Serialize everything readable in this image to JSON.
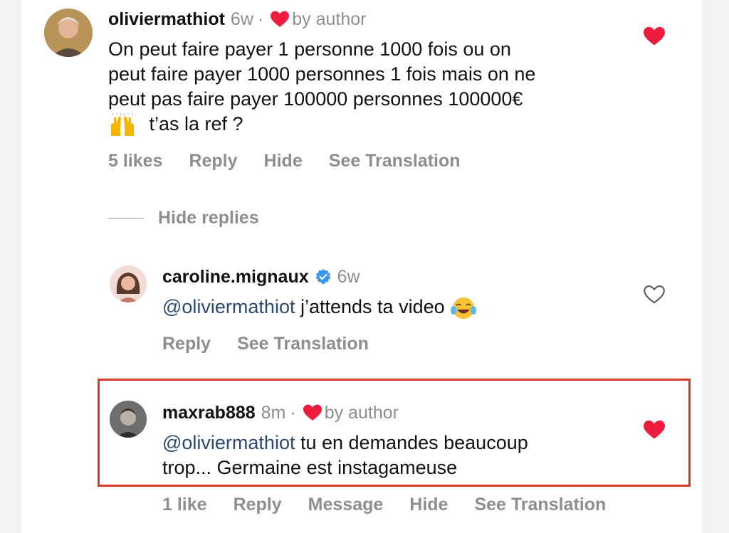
{
  "comments": [
    {
      "username": "oliviermathiot",
      "time": "6w",
      "liked_by": "by author",
      "text_lines": [
        "On peut faire payer 1 personne 1000 fois ou on",
        "peut faire payer 1000 personnes 1 fois mais on ne",
        "peut pas faire payer 100000 personnes 100000€"
      ],
      "text_tail": "t’as la ref ?",
      "emoji": "raising-hands-emoji",
      "likes": "5 likes",
      "actions": [
        "Reply",
        "Hide",
        "See Translation"
      ]
    },
    {
      "username": "caroline.mignaux",
      "time": "6w",
      "verified": true,
      "mention": "@oliviermathiot",
      "text": "j’attends ta video",
      "emoji": "tears-of-joy-emoji",
      "actions": [
        "Reply",
        "See Translation"
      ]
    },
    {
      "username": "maxrab888",
      "time": "8m",
      "liked_by": "by author",
      "mention": "@oliviermathiot",
      "text_line1": "tu en demandes beaucoup",
      "text_line2": "trop... Germaine est instagameuse",
      "likes": "1 like",
      "actions": [
        "Reply",
        "Message",
        "Hide",
        "See Translation"
      ]
    }
  ],
  "hide_replies": "Hide replies",
  "separator": "·",
  "colors": {
    "heart": "#ee1c3d",
    "mention": "#2b4a73",
    "muted": "#8e8e8e",
    "highlight_border": "#d63a26"
  }
}
